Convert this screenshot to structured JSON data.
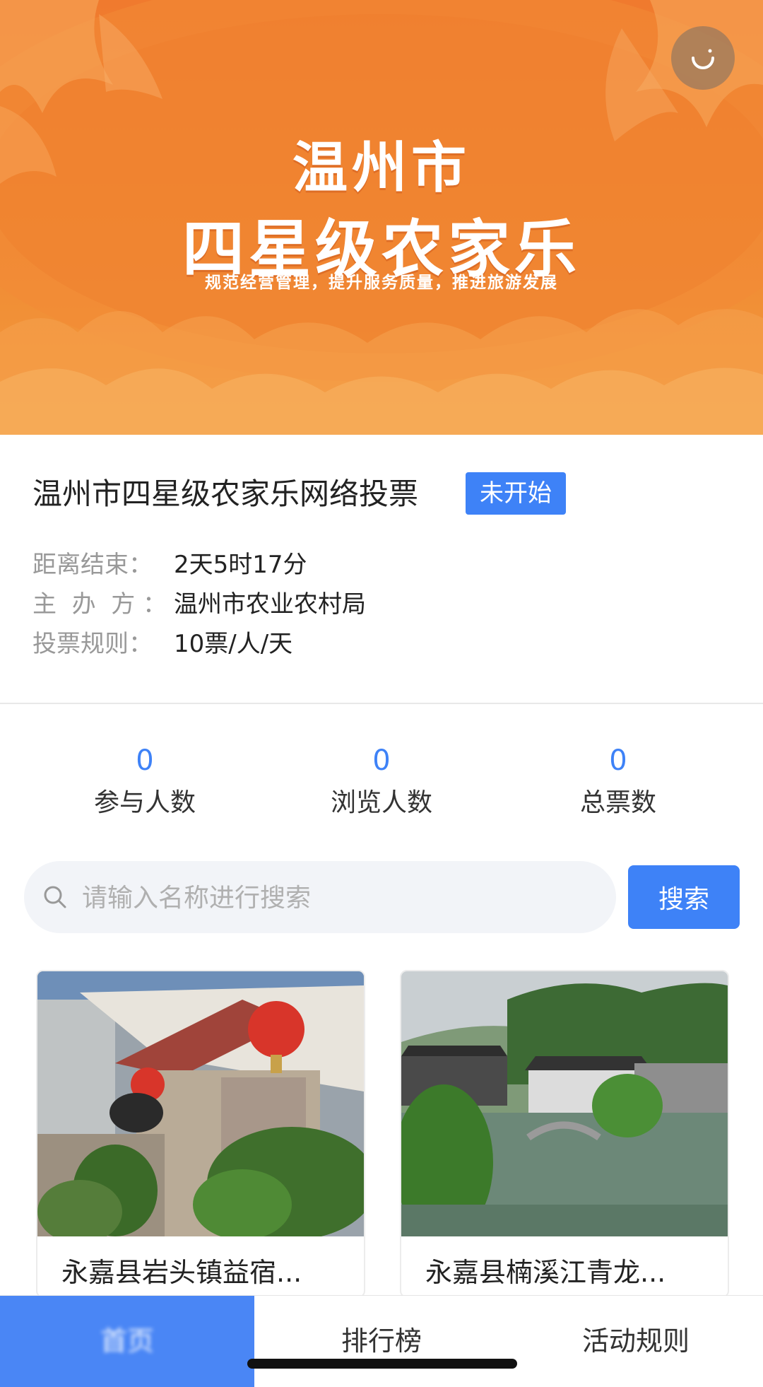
{
  "banner": {
    "title_line1": "温州市",
    "title_line2": "四星级农家乐",
    "subtitle": "规范经营管理，提升服务质量，推进旅游发展",
    "colors": {
      "top": "#f07a2e",
      "bottom": "#f39a3d"
    },
    "corner_button_icon": "loading-icon"
  },
  "event": {
    "title": "温州市四星级农家乐网络投票",
    "status": "未开始",
    "status_color": "#3e82f7",
    "meta": [
      {
        "label": "距离结束：",
        "value": "2天5时17分"
      },
      {
        "label": "主  办  方 ：",
        "value": "温州市农业农村局"
      },
      {
        "label": "投票规则：",
        "value": "10票/人/天"
      }
    ]
  },
  "stats": [
    {
      "value": "0",
      "label": "参与人数"
    },
    {
      "value": "0",
      "label": "浏览人数"
    },
    {
      "value": "0",
      "label": "总票数"
    }
  ],
  "search": {
    "placeholder": "请输入名称进行搜索",
    "value": "",
    "button_label": "搜索"
  },
  "cards": [
    {
      "name": "永嘉县岩头镇益宿...",
      "photo": "guesthouse-entrance-with-red-lanterns"
    },
    {
      "name": "永嘉县楠溪江青龙...",
      "photo": "riverside-village-with-bridge"
    }
  ],
  "tabs": [
    {
      "label": "首页",
      "active": true
    },
    {
      "label": "排行榜",
      "active": false
    },
    {
      "label": "活动规则",
      "active": false
    }
  ],
  "accent_color": "#3e82f7"
}
